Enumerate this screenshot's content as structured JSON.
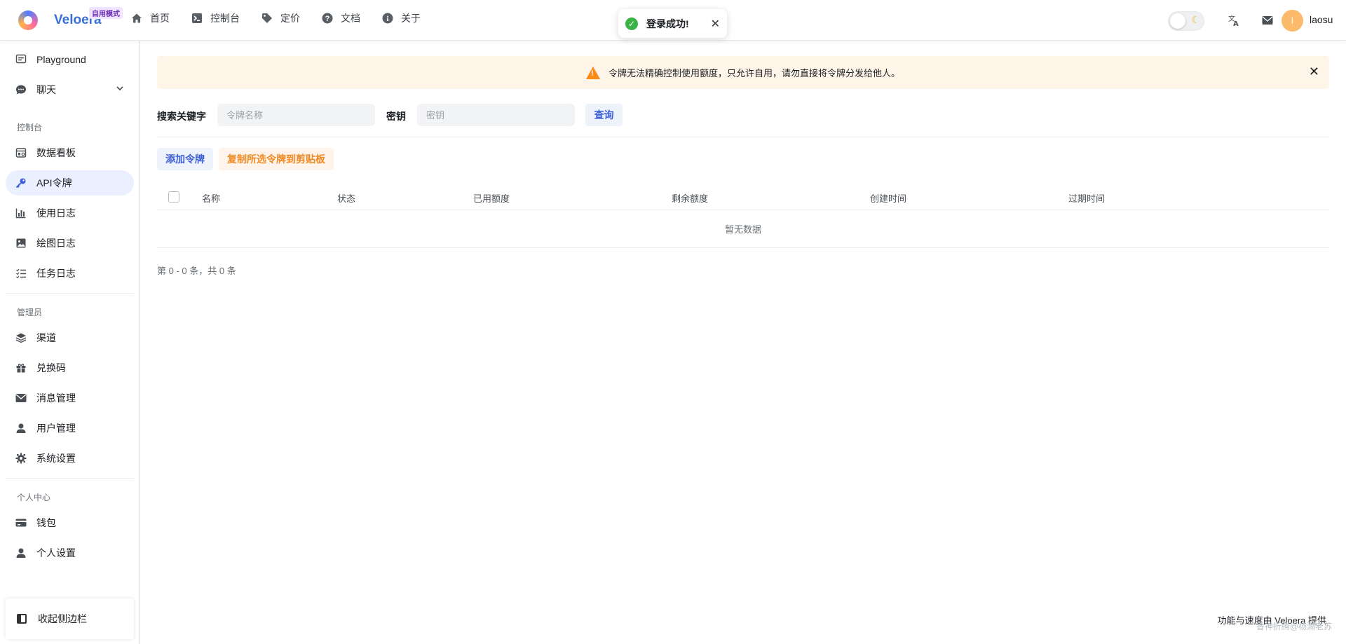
{
  "brand": {
    "name": "Veloera",
    "badge": "自用模式"
  },
  "nav": [
    {
      "label": "首页",
      "icon": "home-icon"
    },
    {
      "label": "控制台",
      "icon": "terminal-icon"
    },
    {
      "label": "定价",
      "icon": "tag-icon"
    },
    {
      "label": "文档",
      "icon": "help-circle-icon"
    },
    {
      "label": "关于",
      "icon": "info-icon"
    }
  ],
  "toast": {
    "message": "登录成功!"
  },
  "user": {
    "avatar_initial": "l",
    "name": "laosu"
  },
  "sidebar": {
    "playground": "Playground",
    "chat": "聊天",
    "group_console": "控制台",
    "dashboard": "数据看板",
    "api_token": "API令牌",
    "usage_log": "使用日志",
    "drawing_log": "绘图日志",
    "task_log": "任务日志",
    "group_admin": "管理员",
    "channel": "渠道",
    "redeem_code": "兑换码",
    "message_mgmt": "消息管理",
    "user_mgmt": "用户管理",
    "system_settings": "系统设置",
    "group_personal": "个人中心",
    "wallet": "钱包",
    "personal_settings": "个人设置",
    "collapse": "收起侧边栏"
  },
  "banner": {
    "text": "令牌无法精确控制使用额度，只允许自用，请勿直接将令牌分发给他人。"
  },
  "search": {
    "keyword_label": "搜索关键字",
    "keyword_placeholder": "令牌名称",
    "key_label": "密钥",
    "key_placeholder": "密钥",
    "query_button": "查询"
  },
  "actions": {
    "add_token": "添加令牌",
    "copy_selected": "复制所选令牌到剪贴板"
  },
  "table": {
    "columns": [
      "名称",
      "状态",
      "已用额度",
      "剩余额度",
      "创建时间",
      "过期时间"
    ],
    "empty_text": "暂无数据"
  },
  "pagination": {
    "text": "第 0 - 0 条，共 0 条"
  },
  "footer": {
    "text": "功能与速度由 Veloera 提供"
  },
  "watermark": "香神折腾@杨浦老苏",
  "colors": {
    "primary": "#3a5fd8",
    "warning": "#f88a15",
    "success": "#3bb346",
    "avatar": "#fbbb6a"
  }
}
